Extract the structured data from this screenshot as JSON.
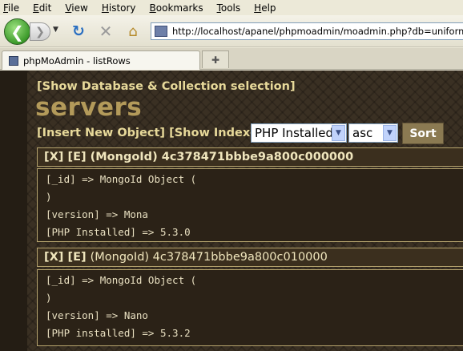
{
  "menu": [
    "File",
    "Edit",
    "View",
    "History",
    "Bookmarks",
    "Tools",
    "Help"
  ],
  "address_bar": {
    "url": "http://localhost/apanel/phpmoadmin/moadmin.php?db=uniform_server&action=listRows"
  },
  "tab": {
    "title": "phpMoAdmin - listRows"
  },
  "page": {
    "selection_link": "[Show Database & Collection selection]",
    "db_title": "servers",
    "insert_link": "[Insert New Object]",
    "indexes_link": "[Show Indexes]",
    "sort_field": "PHP Installed",
    "sort_order": "asc",
    "sort_button": "Sort"
  },
  "records": [
    {
      "delete": "[X]",
      "edit": "[E]",
      "label": "(MongoId) 4c378471bbbe9a800c000000",
      "lines": [
        "[_id] => MongoId Object (",
        ")",
        "[version] => Mona",
        "[PHP Installed] => 5.3.0"
      ]
    },
    {
      "delete": "[X]",
      "edit": "[E]",
      "label": "(MongoId) 4c378471bbbe9a800c010000",
      "lines": [
        "[_id] => MongoId Object (",
        ")",
        "[version] => Nano",
        "[PHP installed] => 5.3.2"
      ]
    }
  ]
}
